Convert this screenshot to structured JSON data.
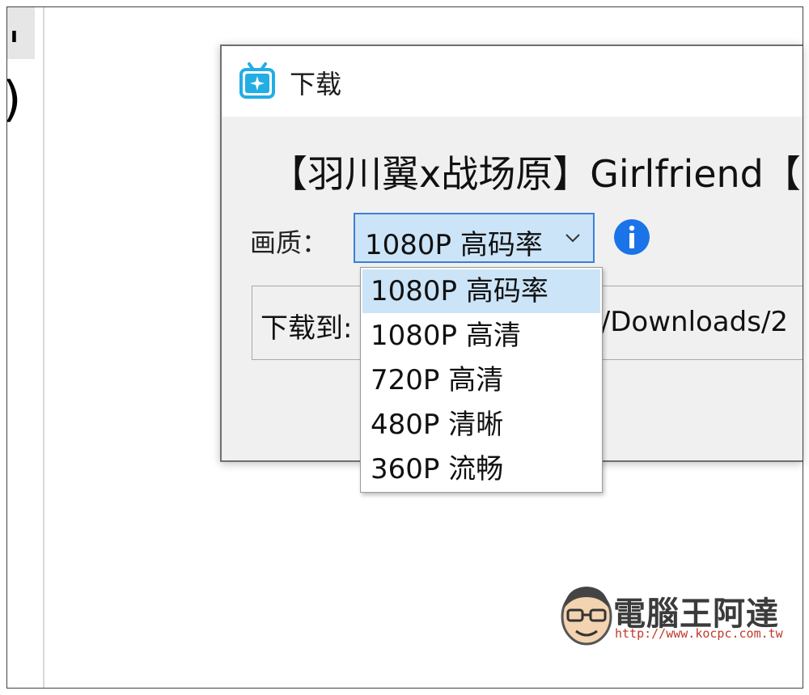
{
  "dialog": {
    "title": "下载",
    "video_title": "【羽川翼x战场原】Girlfriend【",
    "quality_label": "画质：",
    "quality_selected": "1080P 高码率",
    "save_label": "下载到:",
    "save_path_visible": "Y/Downloads/2"
  },
  "dropdown": {
    "options": [
      "1080P 高码率",
      "1080P 高清",
      "720P 高清",
      "480P 清晰",
      "360P 流畅"
    ],
    "selected_index": 0
  },
  "watermark": {
    "name": "電腦王阿達",
    "url": "http://www.kocpc.com.tw"
  },
  "colors": {
    "accent": "#3c7fd6",
    "selection": "#cce4f7",
    "app_icon": "#23ade5",
    "info": "#1a73e8"
  },
  "icons": {
    "app": "bilibili-tv-icon",
    "info": "info-icon",
    "dropdown": "chevron-down-icon"
  }
}
